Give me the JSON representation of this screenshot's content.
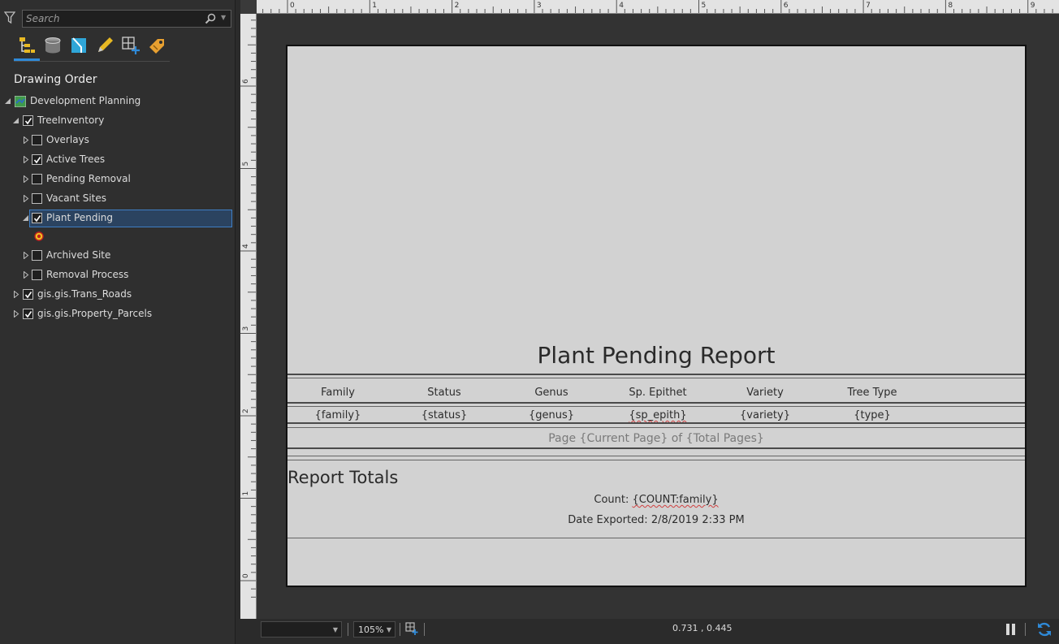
{
  "contents": {
    "search_placeholder": "Search",
    "section_title": "Drawing Order",
    "tree": [
      {
        "label": "Development Planning",
        "type": "map",
        "expanded": true,
        "checked": null
      },
      {
        "label": "TreeInventory",
        "expanded": true,
        "checked": true
      },
      {
        "label": "Overlays",
        "expanded": false,
        "checked": false
      },
      {
        "label": "Active Trees",
        "expanded": false,
        "checked": true
      },
      {
        "label": "Pending Removal",
        "expanded": false,
        "checked": false
      },
      {
        "label": "Vacant Sites",
        "expanded": false,
        "checked": false
      },
      {
        "label": "Plant Pending",
        "expanded": true,
        "checked": true,
        "selected": true
      },
      {
        "label": "Archived Site",
        "expanded": false,
        "checked": false
      },
      {
        "label": "Removal Process",
        "expanded": false,
        "checked": false
      },
      {
        "label": "gis.gis.Trans_Roads",
        "expanded": false,
        "checked": true
      },
      {
        "label": "gis.gis.Property_Parcels",
        "expanded": false,
        "checked": true
      }
    ],
    "toolbar_icons": [
      "drawing-order-icon",
      "data-source-icon",
      "selection-icon",
      "editing-icon",
      "snapping-icon",
      "labeling-icon"
    ]
  },
  "report": {
    "title": "Plant Pending Report",
    "columns": [
      "Family",
      "Status",
      "Genus",
      "Sp. Epithet",
      "Variety",
      "Tree Type"
    ],
    "fields": [
      "{family}",
      "{status}",
      "{genus}",
      "{sp_epith}",
      "{variety}",
      "{type}"
    ],
    "page_footer": "Page {Current Page} of {Total Pages}",
    "totals_title": "Report Totals",
    "count_label": "Count: ",
    "count_value": "{COUNT:family}",
    "date_label": "Date Exported: ",
    "date_value": "2/8/2019 2:33 PM"
  },
  "rulers": {
    "top_labels": [
      "0",
      "1",
      "2",
      "3",
      "4",
      "5",
      "6",
      "7",
      "8",
      "9"
    ],
    "left_labels": [
      "6",
      "5",
      "4",
      "3",
      "2",
      "1",
      "0"
    ]
  },
  "statusbar": {
    "scale": "",
    "zoom": "105%",
    "coordinates": "0.731 , 0.445"
  },
  "colors": {
    "accent": "#2f8ad8",
    "selection_bg": "#2b4360",
    "page_bg": "#d2d2d2"
  }
}
